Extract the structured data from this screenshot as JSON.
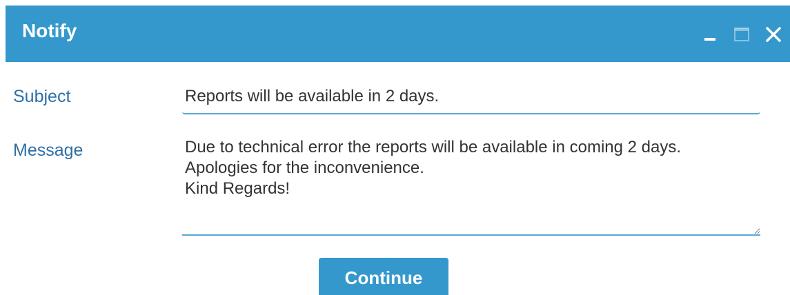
{
  "window": {
    "title": "Notify",
    "controls": [
      {
        "name": "minimize-icon",
        "glyph": "minimize"
      },
      {
        "name": "maximize-icon",
        "glyph": "maximize"
      },
      {
        "name": "close-icon",
        "glyph": "close"
      }
    ]
  },
  "form": {
    "subject_label": "Subject",
    "subject_value": "Reports will be available in 2 days.",
    "message_label": "Message",
    "message_value": "Due to technical error the reports will be available in coming 2 days.\nApologies for the inconvenience.\nKind Regards!"
  },
  "actions": {
    "continue_label": "Continue"
  },
  "colors": {
    "accent": "#3498cc",
    "label": "#2d6fa6",
    "underline": "#5aa6d6",
    "text": "#333333"
  }
}
